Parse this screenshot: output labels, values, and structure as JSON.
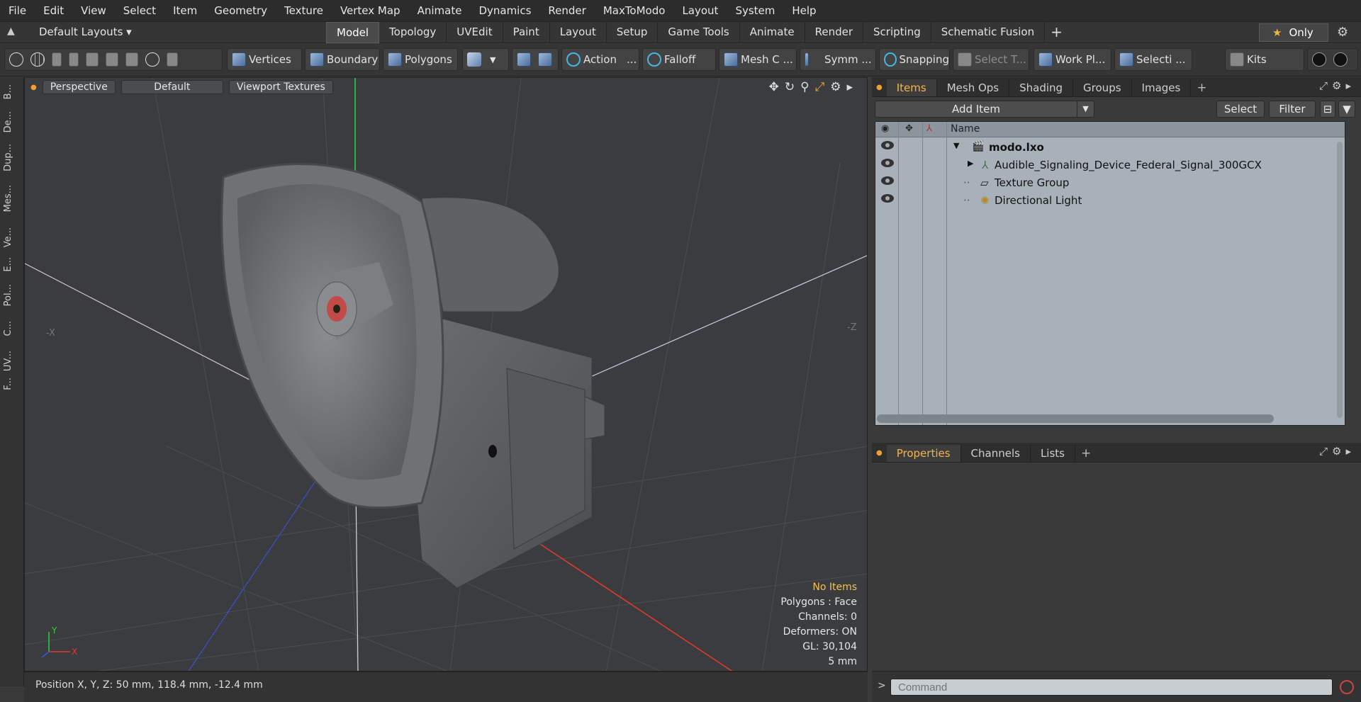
{
  "menubar": {
    "items": [
      "File",
      "Edit",
      "View",
      "Select",
      "Item",
      "Geometry",
      "Texture",
      "Vertex Map",
      "Animate",
      "Dynamics",
      "Render",
      "MaxToModo",
      "Layout",
      "System",
      "Help"
    ]
  },
  "layoutbar": {
    "layouts_label": "Default Layouts",
    "tabs": [
      "Model",
      "Topology",
      "UVEdit",
      "Paint",
      "Layout",
      "Setup",
      "Game Tools",
      "Animate",
      "Render",
      "Scripting",
      "Schematic Fusion"
    ],
    "active_tab": "Model",
    "only_label": "Only"
  },
  "toolbar": {
    "vertices": "Vertices",
    "boundary": "Boundary",
    "polygons": "Polygons",
    "action": "Action",
    "action_more": "...",
    "falloff": "Falloff",
    "mesh_c": "Mesh C ...",
    "symm": "Symm ...",
    "snapping": "Snapping",
    "select_t": "Select T...",
    "work_pl": "Work Pl...",
    "selecti": "Selecti ...",
    "kits": "Kits"
  },
  "left_strip": [
    "B...",
    "De...",
    "Dup...",
    "Mes...",
    "Ve...",
    "E...",
    "Pol...",
    "C...",
    "UV...",
    "F..."
  ],
  "viewport": {
    "projection": "Perspective",
    "shading": "Default",
    "textures": "Viewport Textures",
    "axis_neg_x": "-X",
    "axis_neg_z": "-Z",
    "gizmo_y": "Y",
    "gizmo_x": "X",
    "info": {
      "no_items": "No Items",
      "polygons": "Polygons : Face",
      "channels": "Channels: 0",
      "deformers": "Deformers: ON",
      "gl": "GL: 30,104",
      "scale": "5 mm"
    }
  },
  "statusbar": {
    "position": "Position X, Y, Z:   50 mm, 118.4 mm, -12.4 mm"
  },
  "items_panel": {
    "tabs": [
      "Items",
      "Mesh Ops",
      "Shading",
      "Groups",
      "Images"
    ],
    "active_tab": "Items",
    "add_item": "Add Item",
    "select": "Select",
    "filter": "Filter",
    "column_name": "Name",
    "rows": [
      {
        "label": "modo.lxo"
      },
      {
        "label": "Audible_Signaling_Device_Federal_Signal_300GCX"
      },
      {
        "label": "Texture Group"
      },
      {
        "label": "Directional Light"
      }
    ]
  },
  "properties_panel": {
    "tabs": [
      "Properties",
      "Channels",
      "Lists"
    ],
    "active_tab": "Properties"
  },
  "command": {
    "placeholder": "Command"
  },
  "colors": {
    "accent": "#f4b44a",
    "axis_x": "#e03a30",
    "axis_y": "#2fcf3b",
    "axis_z": "#3b55e0",
    "tree_bg": "#a8b1b9"
  }
}
